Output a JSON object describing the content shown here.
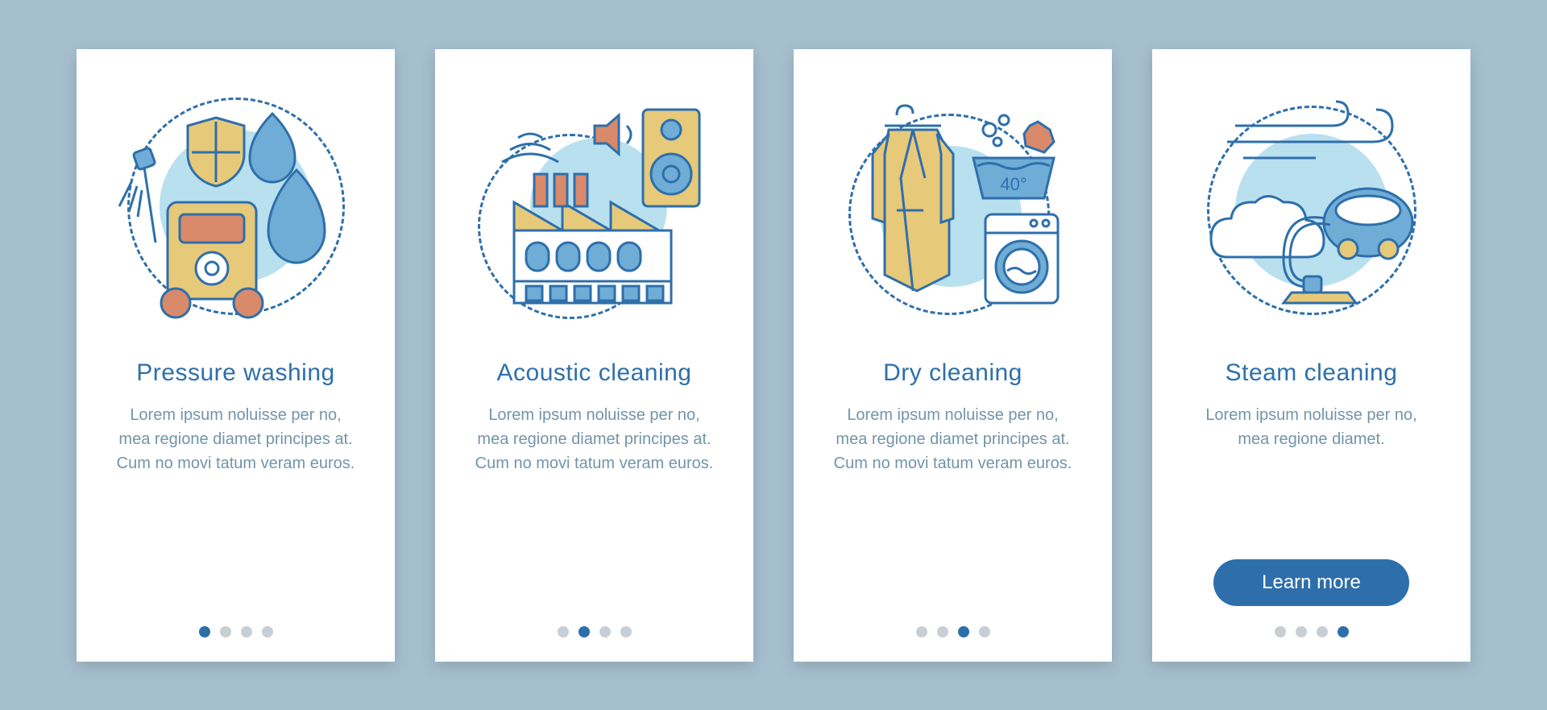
{
  "cards": [
    {
      "title": "Pressure washing",
      "body": "Lorem ipsum noluisse per no, mea regione diamet principes at. Cum no movi tatum veram euros.",
      "active_dot": 0,
      "has_button": false
    },
    {
      "title": "Acoustic cleaning",
      "body": "Lorem ipsum noluisse per no, mea regione diamet principes at. Cum no movi tatum veram euros.",
      "active_dot": 1,
      "has_button": false
    },
    {
      "title": "Dry cleaning",
      "body": "Lorem ipsum noluisse per no, mea regione diamet principes at. Cum no movi tatum veram euros.",
      "active_dot": 2,
      "has_button": false
    },
    {
      "title": "Steam cleaning",
      "body": "Lorem ipsum noluisse per no, mea regione diamet.",
      "active_dot": 3,
      "has_button": true
    }
  ],
  "button_label": "Learn more",
  "dry_cleaning_temp": "40°",
  "colors": {
    "bg": "#a6bfcf",
    "accent": "#2e6fab",
    "text": "#7295a7",
    "light_blue": "#b9e0ef",
    "yellow": "#e7c97a",
    "coral": "#d98a6b"
  }
}
